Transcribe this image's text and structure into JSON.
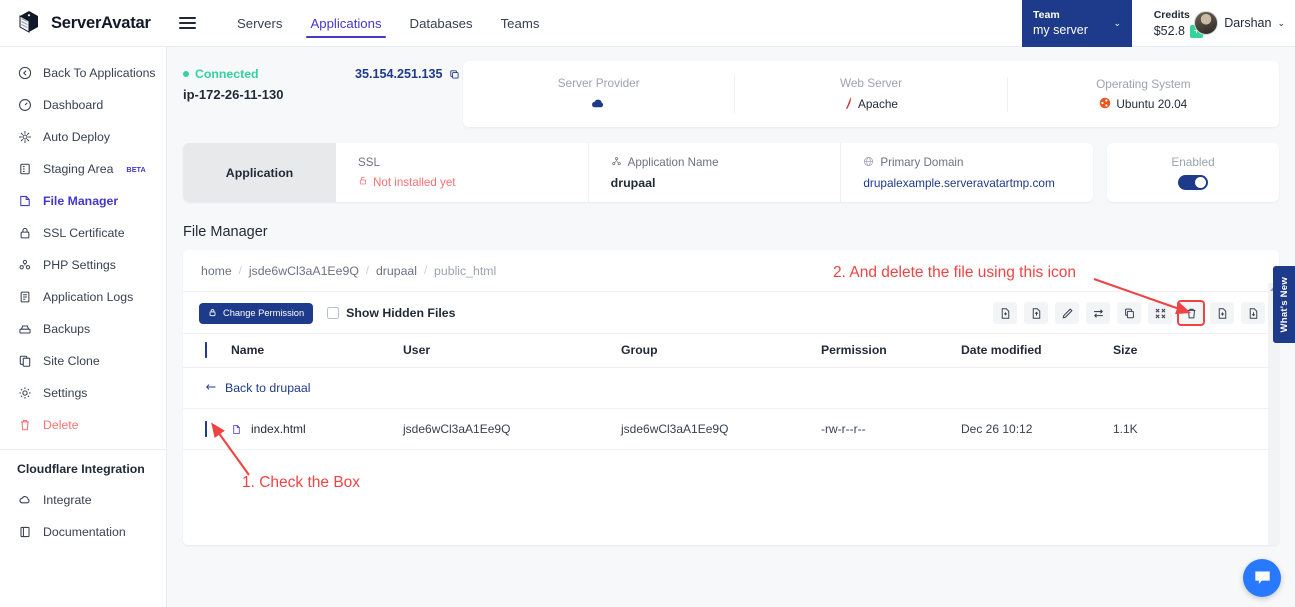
{
  "topnav": {
    "brand": "ServerAvatar",
    "menu_icon": "hamburger-icon",
    "links": [
      {
        "label": "Servers",
        "active": false
      },
      {
        "label": "Applications",
        "active": true
      },
      {
        "label": "Databases",
        "active": false
      },
      {
        "label": "Teams",
        "active": false
      }
    ],
    "team": {
      "label": "Team",
      "value": "my server",
      "caret": "⌄"
    },
    "credits": {
      "label": "Credits",
      "value": "$52.8",
      "add": "+"
    },
    "user": {
      "name": "Darshan",
      "caret": "⌄"
    }
  },
  "sidebar": {
    "items": [
      {
        "label": "Back To Applications",
        "icon": "back-circle-icon"
      },
      {
        "label": "Dashboard",
        "icon": "gauge-icon"
      },
      {
        "label": "Auto Deploy",
        "icon": "deploy-icon"
      },
      {
        "label": "Staging Area",
        "icon": "staging-icon",
        "badge": "BETA"
      },
      {
        "label": "File Manager",
        "icon": "folder-icon",
        "active": true
      },
      {
        "label": "SSL Certificate",
        "icon": "lock-icon"
      },
      {
        "label": "PHP Settings",
        "icon": "php-icon"
      },
      {
        "label": "Application Logs",
        "icon": "log-icon"
      },
      {
        "label": "Backups",
        "icon": "backup-icon"
      },
      {
        "label": "Site Clone",
        "icon": "clone-icon"
      },
      {
        "label": "Settings",
        "icon": "gear-icon"
      },
      {
        "label": "Delete",
        "icon": "trash-icon",
        "danger": true
      }
    ],
    "section_title": "Cloudflare Integration",
    "section_items": [
      {
        "label": "Integrate",
        "icon": "cloud-icon"
      },
      {
        "label": "Documentation",
        "icon": "book-icon"
      }
    ]
  },
  "server": {
    "status": "Connected",
    "hostname": "ip-172-26-11-130",
    "ip": "35.154.251.135",
    "copy_icon": "copy-icon",
    "cards": [
      {
        "label": "Server Provider",
        "value": "",
        "icon": "cloud-icon"
      },
      {
        "label": "Web Server",
        "value": "Apache",
        "icon": "apache-feather-icon"
      },
      {
        "label": "Operating System",
        "value": "Ubuntu 20.04",
        "icon": "ubuntu-icon"
      }
    ]
  },
  "application": {
    "tag": "Application",
    "ssl": {
      "label": "SSL",
      "value": "Not installed yet",
      "icon": "open-lock-icon"
    },
    "name": {
      "label": "Application Name",
      "value": "drupaal",
      "icon": "app-icon"
    },
    "domain": {
      "label": "Primary Domain",
      "value": "drupalexample.serveravatartmp.com",
      "icon": "globe-icon"
    },
    "enabled": {
      "label": "Enabled",
      "state": "on"
    }
  },
  "file_manager": {
    "title": "File Manager",
    "breadcrumbs": [
      "home",
      "jsde6wCl3aA1Ee9Q",
      "drupaal",
      "public_html"
    ],
    "breadcrumb_sep": "/",
    "change_permission_button": "Change Permission",
    "change_permission_icon": "lock-icon",
    "show_hidden_label": "Show Hidden Files",
    "show_hidden_checked": false,
    "toolbar_icons": [
      {
        "name": "new-file-icon",
        "marked": false
      },
      {
        "name": "upload-file-icon",
        "marked": false
      },
      {
        "name": "rename-pencil-icon",
        "marked": false
      },
      {
        "name": "move-arrows-icon",
        "marked": false
      },
      {
        "name": "copy-icon",
        "marked": false
      },
      {
        "name": "compress-icon",
        "marked": false
      },
      {
        "name": "delete-trash-icon",
        "marked": true
      },
      {
        "name": "extract-icon",
        "marked": false
      },
      {
        "name": "download-icon",
        "marked": false
      }
    ],
    "select_all_checked": true,
    "columns": [
      "Name",
      "User",
      "Group",
      "Permission",
      "Date modified",
      "Size"
    ],
    "back_row": {
      "label": "Back to drupaal",
      "icon": "arrow-left-icon"
    },
    "rows": [
      {
        "checked": true,
        "icon": "html-file-icon",
        "name": "index.html",
        "user": "jsde6wCl3aA1Ee9Q",
        "group": "jsde6wCl3aA1Ee9Q",
        "permission": "-rw-r--r--",
        "date_modified": "Dec 26 10:12",
        "size": "1.1K"
      }
    ]
  },
  "annotations": [
    {
      "id": "anno1",
      "text": "1. Check the Box"
    },
    {
      "id": "anno2",
      "text": "2. And delete the file using this icon"
    }
  ],
  "rail": {
    "whats_new": "What's New",
    "chat_icon": "chat-bubble-icon"
  },
  "colors": {
    "brand_navy": "#1e3a8a",
    "accent_indigo": "#4338ca",
    "success_green": "#34d399",
    "danger_red": "#ef4444",
    "soft_red": "#f87171",
    "page_bg": "#f7f8fa"
  }
}
